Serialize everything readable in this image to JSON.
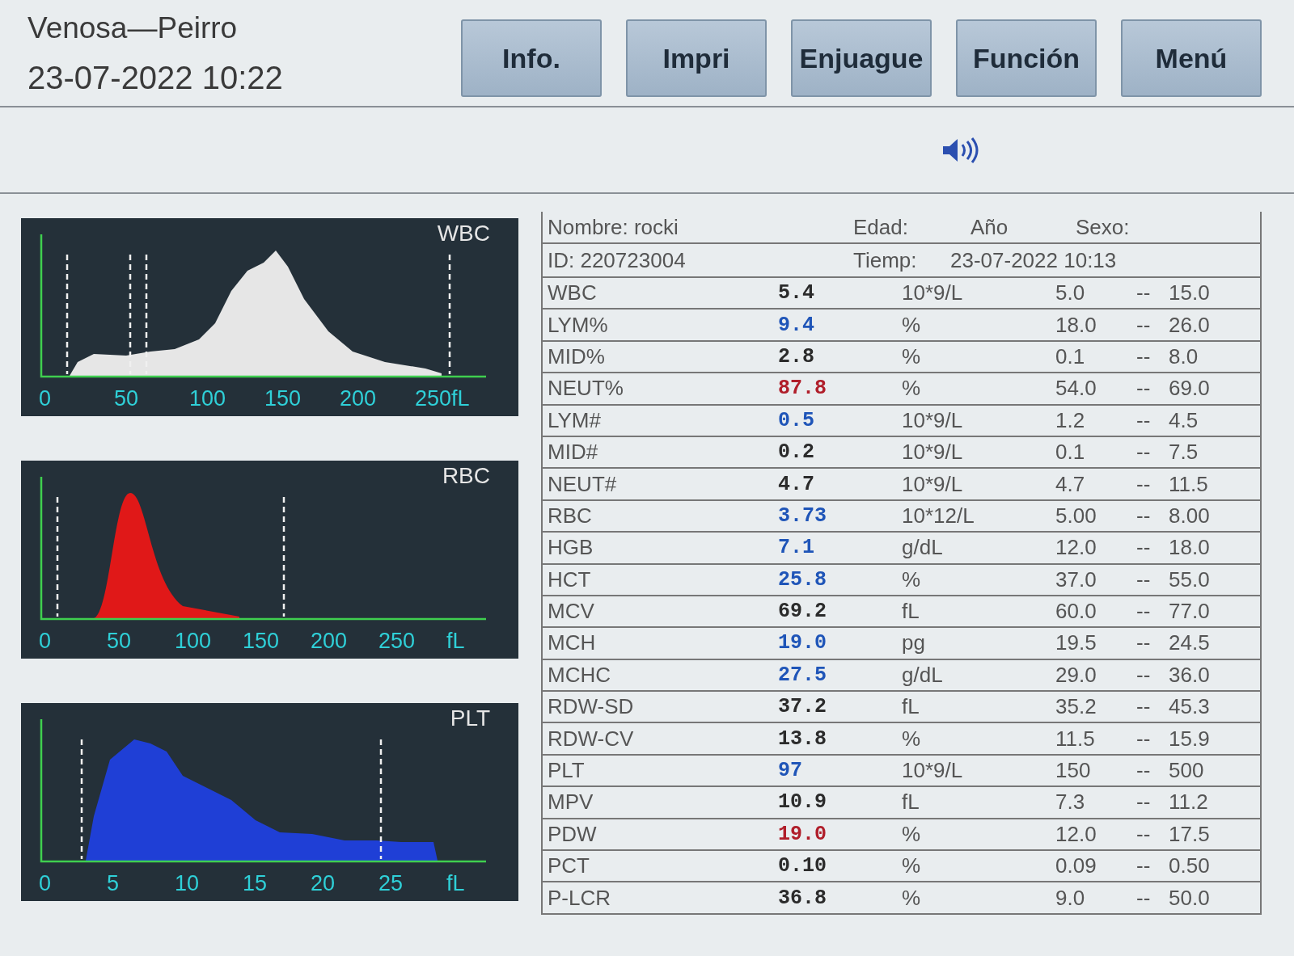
{
  "header": {
    "title": "Venosa—Peirro",
    "datetime": "23-07-2022 10:22"
  },
  "buttons": [
    "Info.",
    "Impri",
    "Enjuague",
    "Función",
    "Menú"
  ],
  "histograms": [
    {
      "label": "WBC",
      "color": "#e6e6e6",
      "x_labels": [
        "0",
        "50",
        "100",
        "150",
        "200",
        "250fL"
      ]
    },
    {
      "label": "RBC",
      "color": "#e01818",
      "x_labels": [
        "0",
        "50",
        "100",
        "150",
        "200",
        "250",
        "fL"
      ]
    },
    {
      "label": "PLT",
      "color": "#1f3fd6",
      "x_labels": [
        "0",
        "5",
        "10",
        "15",
        "20",
        "25",
        "fL"
      ]
    }
  ],
  "patient": {
    "name_label": "Nombre:",
    "name": "rocki",
    "age_label": "Edad:",
    "age_unit": "Año",
    "sex_label": "Sexo:",
    "id_label": "ID:",
    "id": "220723004",
    "time_label": "Tiemp:",
    "time": "23-07-2022 10:13"
  },
  "results": [
    {
      "param": "WBC",
      "value": "5.4",
      "color": "#2b2b2b",
      "unit": "10*9/L",
      "low": "5.0",
      "separator": "--",
      "high": "15.0"
    },
    {
      "param": "LYM%",
      "value": "9.4",
      "color": "#1f55b8",
      "unit": "%",
      "low": "18.0",
      "separator": "--",
      "high": "26.0"
    },
    {
      "param": "MID%",
      "value": "2.8",
      "color": "#2b2b2b",
      "unit": "%",
      "low": "0.1",
      "separator": "--",
      "high": "8.0"
    },
    {
      "param": "NEUT%",
      "value": "87.8",
      "color": "#b01e2a",
      "unit": "%",
      "low": "54.0",
      "separator": "--",
      "high": "69.0"
    },
    {
      "param": "LYM#",
      "value": "0.5",
      "color": "#1f55b8",
      "unit": "10*9/L",
      "low": "1.2",
      "separator": "--",
      "high": "4.5"
    },
    {
      "param": "MID#",
      "value": "0.2",
      "color": "#2b2b2b",
      "unit": "10*9/L",
      "low": "0.1",
      "separator": "--",
      "high": "7.5"
    },
    {
      "param": "NEUT#",
      "value": "4.7",
      "color": "#2b2b2b",
      "unit": "10*9/L",
      "low": "4.7",
      "separator": "--",
      "high": "11.5"
    },
    {
      "param": "RBC",
      "value": "3.73",
      "color": "#1f55b8",
      "unit": "10*12/L",
      "low": "5.00",
      "separator": "--",
      "high": "8.00"
    },
    {
      "param": "HGB",
      "value": "7.1",
      "color": "#1f55b8",
      "unit": "g/dL",
      "low": "12.0",
      "separator": "--",
      "high": "18.0"
    },
    {
      "param": "HCT",
      "value": "25.8",
      "color": "#1f55b8",
      "unit": "%",
      "low": "37.0",
      "separator": "--",
      "high": "55.0"
    },
    {
      "param": "MCV",
      "value": "69.2",
      "color": "#2b2b2b",
      "unit": "fL",
      "low": "60.0",
      "separator": "--",
      "high": "77.0"
    },
    {
      "param": "MCH",
      "value": "19.0",
      "color": "#1f55b8",
      "unit": "pg",
      "low": "19.5",
      "separator": "--",
      "high": "24.5"
    },
    {
      "param": "MCHC",
      "value": "27.5",
      "color": "#1f55b8",
      "unit": "g/dL",
      "low": "29.0",
      "separator": "--",
      "high": "36.0"
    },
    {
      "param": "RDW-SD",
      "value": "37.2",
      "color": "#2b2b2b",
      "unit": "fL",
      "low": "35.2",
      "separator": "--",
      "high": "45.3"
    },
    {
      "param": "RDW-CV",
      "value": "13.8",
      "color": "#2b2b2b",
      "unit": "%",
      "low": "11.5",
      "separator": "--",
      "high": "15.9"
    },
    {
      "param": "PLT",
      "value": "97",
      "color": "#1f55b8",
      "unit": "10*9/L",
      "low": "150",
      "separator": "--",
      "high": "500"
    },
    {
      "param": "MPV",
      "value": "10.9",
      "color": "#2b2b2b",
      "unit": "fL",
      "low": "7.3",
      "separator": "--",
      "high": "11.2"
    },
    {
      "param": "PDW",
      "value": "19.0",
      "color": "#b01e2a",
      "unit": "%",
      "low": "12.0",
      "separator": "--",
      "high": "17.5"
    },
    {
      "param": "PCT",
      "value": "0.10",
      "color": "#2b2b2b",
      "unit": "%",
      "low": "0.09",
      "separator": "--",
      "high": "0.50"
    },
    {
      "param": "P-LCR",
      "value": "36.8",
      "color": "#2b2b2b",
      "unit": "%",
      "low": "9.0",
      "separator": "--",
      "high": "50.0"
    }
  ]
}
